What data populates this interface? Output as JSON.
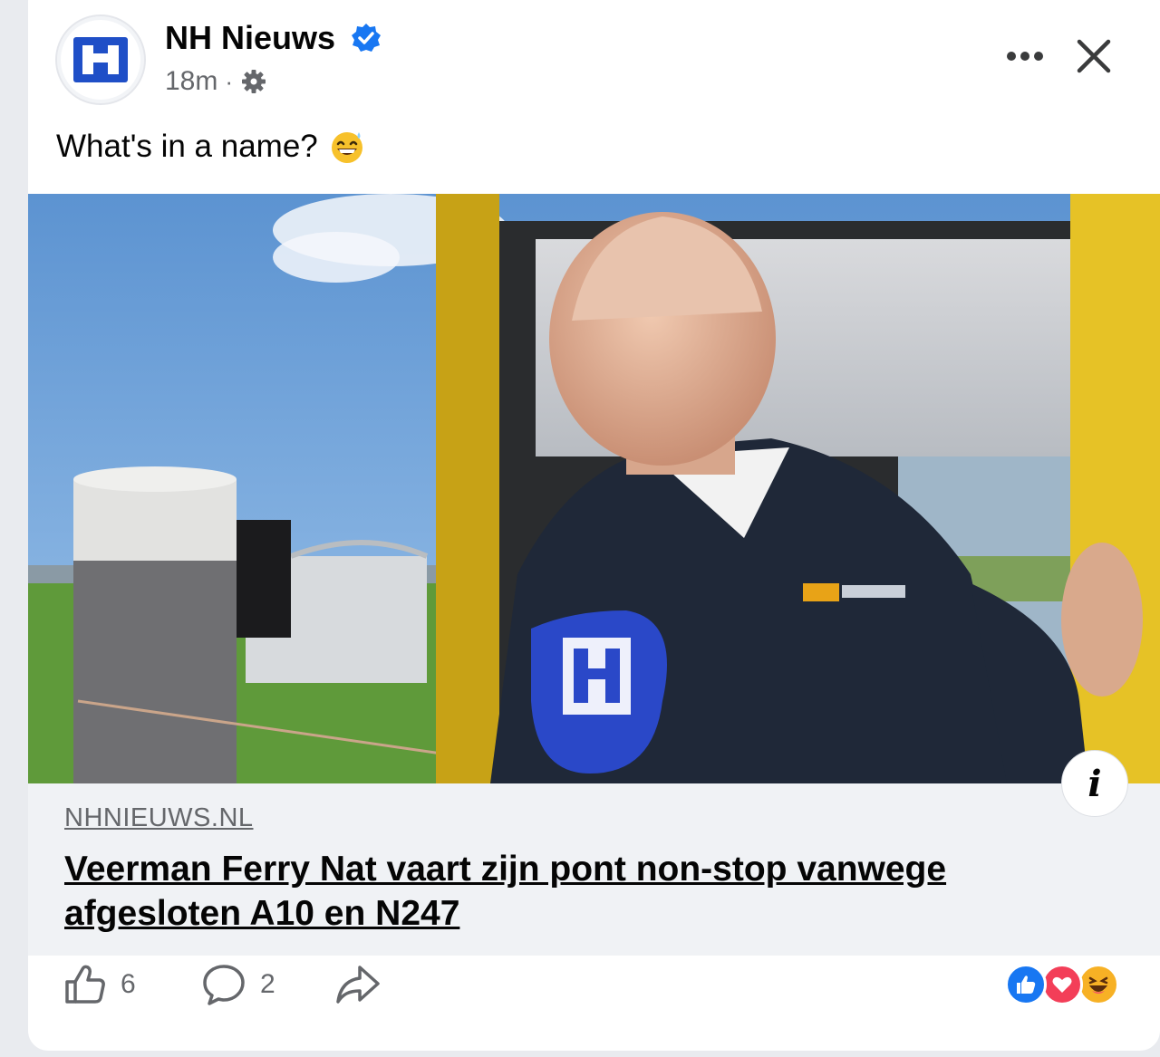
{
  "post": {
    "page_name": "NH Nieuws",
    "timestamp": "18m",
    "separator": "·",
    "privacy_icon": "gear-icon",
    "text": "What's in a name?",
    "text_emoji": "grinning-face-with-sweat-emoji"
  },
  "header_actions": {
    "more_icon": "more-icon",
    "close_icon": "close-icon"
  },
  "link_preview": {
    "domain": "NHNIEUWS.NL",
    "title": "Veerman Ferry Nat vaart zijn pont non-stop vanwege afgesloten A10 en N247",
    "info_label": "i"
  },
  "footer": {
    "like_count": "6",
    "comment_count": "2",
    "reactions": [
      "like-reaction-icon",
      "love-reaction-icon",
      "haha-reaction-icon"
    ]
  },
  "colors": {
    "brand_blue": "#1f4fc7",
    "verified_blue": "#1877f2",
    "secondary_text": "#65676b",
    "link_bg": "#f0f2f5",
    "love_red": "#f33e58",
    "haha_yellow": "#f7b125"
  }
}
